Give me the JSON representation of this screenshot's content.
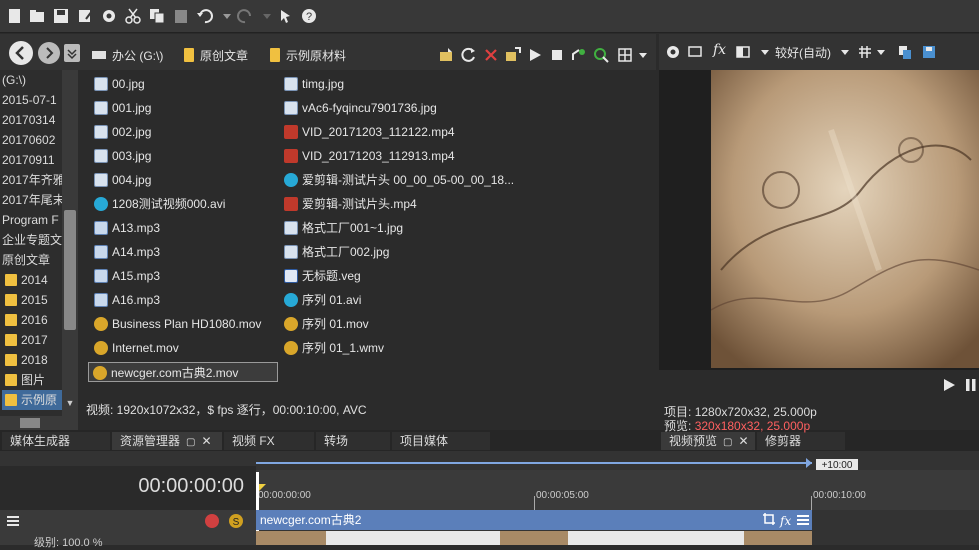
{
  "explorer": {
    "breadcrumbs": [
      {
        "label": "办公 (G:\\)",
        "icon": "drive-icon"
      },
      {
        "label": "原创文章",
        "icon": "folder-icon"
      },
      {
        "label": "示例原材料",
        "icon": "folder-icon"
      }
    ],
    "tree_items": [
      {
        "label": "(G:\\)",
        "folder": false
      },
      {
        "label": "2015-07-1",
        "folder": false
      },
      {
        "label": "20170314",
        "folder": false
      },
      {
        "label": "20170602",
        "folder": false
      },
      {
        "label": "20170911",
        "folder": false
      },
      {
        "label": "2017年齐雅",
        "folder": false
      },
      {
        "label": "2017年尾末",
        "folder": false
      },
      {
        "label": "Program F",
        "folder": false
      },
      {
        "label": "企业专题文",
        "folder": false
      },
      {
        "label": "原创文章",
        "folder": false
      },
      {
        "label": "2014",
        "folder": true
      },
      {
        "label": "2015",
        "folder": true
      },
      {
        "label": "2016",
        "folder": true
      },
      {
        "label": "2017",
        "folder": true
      },
      {
        "label": "2018",
        "folder": true
      },
      {
        "label": "图片",
        "folder": true
      },
      {
        "label": "示例原",
        "folder": true,
        "selected": true
      }
    ],
    "files_col1": [
      {
        "name": "00.jpg",
        "type": "img"
      },
      {
        "name": "001.jpg",
        "type": "img"
      },
      {
        "name": "002.jpg",
        "type": "img"
      },
      {
        "name": "003.jpg",
        "type": "img"
      },
      {
        "name": "004.jpg",
        "type": "img"
      },
      {
        "name": "1208测试视频000.avi",
        "type": "avi"
      },
      {
        "name": "A13.mp3",
        "type": "mp3"
      },
      {
        "name": "A14.mp3",
        "type": "mp3"
      },
      {
        "name": "A15.mp3",
        "type": "mp3"
      },
      {
        "name": "A16.mp3",
        "type": "mp3"
      },
      {
        "name": "Business Plan HD1080.mov",
        "type": "mov"
      },
      {
        "name": "Internet.mov",
        "type": "mov"
      },
      {
        "name": "newcger.com古典2.mov",
        "type": "mov",
        "selected": true
      }
    ],
    "files_col2": [
      {
        "name": "timg.jpg",
        "type": "img"
      },
      {
        "name": "vAc6-fyqincu7901736.jpg",
        "type": "img"
      },
      {
        "name": "VID_20171203_112122.mp4",
        "type": "mp4"
      },
      {
        "name": "VID_20171203_112913.mp4",
        "type": "mp4"
      },
      {
        "name": "爱剪辑-测试片头 00_00_05-00_00_18...",
        "type": "avi"
      },
      {
        "name": "爱剪辑-测试片头.mp4",
        "type": "mp4"
      },
      {
        "name": "格式工厂001~1.jpg",
        "type": "img"
      },
      {
        "name": "格式工厂002.jpg",
        "type": "img"
      },
      {
        "name": "无标题.veg",
        "type": "veg"
      },
      {
        "name": "序列 01.avi",
        "type": "avi"
      },
      {
        "name": "序列 01.mov",
        "type": "mov"
      },
      {
        "name": "序列 01_1.wmv",
        "type": "wmv"
      }
    ],
    "status": "视频: 1920x1072x32，$ fps 逐行，00:00:10:00, AVC"
  },
  "tabs_left": [
    "媒体生成器",
    "资源管理器",
    "视频 FX",
    "转场",
    "项目媒体"
  ],
  "tabs_right": [
    "视频预览",
    "修剪器"
  ],
  "preview": {
    "quality": "较好(自动)",
    "project_label": "项目:",
    "project_value": "1280x720x32, 25.000p",
    "preview_label": "预览:",
    "preview_value": "320x180x32, 25.000p",
    "preview_value_color": "#ff6060"
  },
  "timeline": {
    "timecode": "00:00:00:00",
    "duration_badge": "+10:00",
    "ruler_marks": [
      "00:00:00:00",
      "00:00:05:00",
      "00:00:10:00"
    ],
    "clip_name": "newcger.com古典2",
    "level_label": "级别: 100.0 %"
  },
  "colors": {
    "accent": "#5b7fba",
    "folder": "#f0c040",
    "selection": "#3f6a9a"
  }
}
